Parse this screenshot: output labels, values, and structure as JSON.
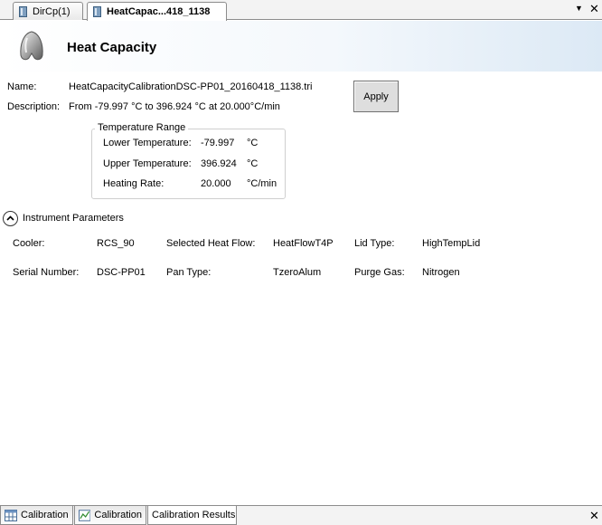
{
  "tabs": [
    {
      "label": "DirCp(1)"
    },
    {
      "label": "HeatCapac...418_1138"
    }
  ],
  "header": {
    "title": "Heat Capacity"
  },
  "file": {
    "name_label": "Name:",
    "name_value": "HeatCapacityCalibrationDSC-PP01_20160418_1138.tri",
    "description_label": "Description:",
    "description_value": "From -79.997 °C to 396.924 °C at 20.000°C/min"
  },
  "apply_label": "Apply",
  "temperature_range": {
    "legend": "Temperature Range",
    "rows": [
      {
        "label": "Lower Temperature:",
        "value": "-79.997",
        "unit": "°C"
      },
      {
        "label": "Upper Temperature:",
        "value": "396.924",
        "unit": "°C"
      },
      {
        "label": "Heating Rate:",
        "value": "20.000",
        "unit": "°C/min"
      }
    ]
  },
  "instrument": {
    "section_title": "Instrument Parameters",
    "cooler_label": "Cooler:",
    "cooler_value": "RCS_90",
    "heat_flow_label": "Selected Heat Flow:",
    "heat_flow_value": "HeatFlowT4P",
    "lid_label": "Lid Type:",
    "lid_value": "HighTempLid",
    "serial_label": "Serial Number:",
    "serial_value": "DSC-PP01",
    "pan_label": "Pan Type:",
    "pan_value": "TzeroAlum",
    "purge_label": "Purge Gas:",
    "purge_value": "Nitrogen"
  },
  "bottom_tabs": [
    {
      "label": "Calibration",
      "icon": "table-icon"
    },
    {
      "label": "Calibration",
      "icon": "chart-icon"
    },
    {
      "label": "Calibration Results",
      "icon": ""
    }
  ],
  "colors": {
    "header_gradient_end": "#dce9f5",
    "tab_border": "#8c8c8c"
  }
}
